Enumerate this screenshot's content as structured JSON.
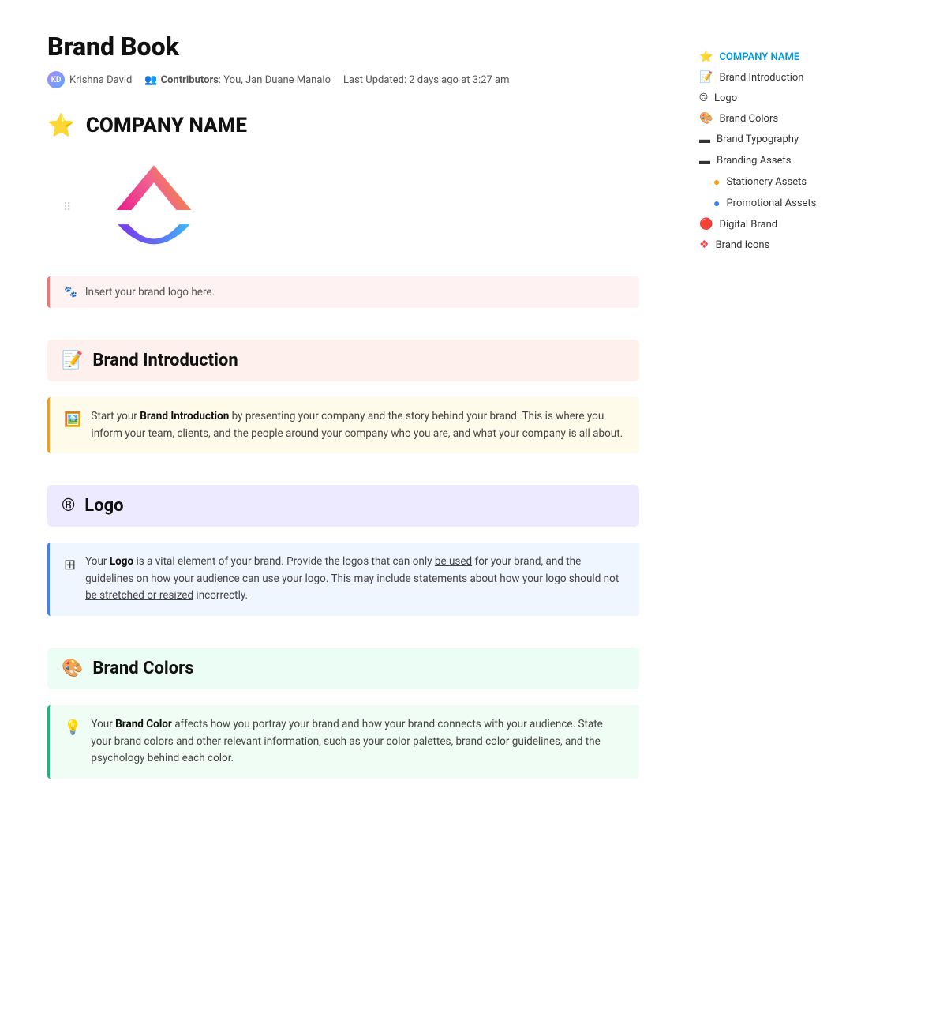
{
  "page": {
    "title": "Brand Book",
    "author": "Krishna David",
    "contributors_label": "Contributors",
    "contributors": "You, Jan Duane Manalo",
    "last_updated": "Last Updated: 2 days ago at 3:27 am",
    "company_name": "COMPANY NAME"
  },
  "logo_callout": {
    "text": "Insert your brand logo here."
  },
  "sections": [
    {
      "id": "brand-introduction",
      "icon": "📝",
      "title": "Brand Introduction",
      "bg": "pink-bg",
      "callout_type": "yellow-left",
      "callout_icon": "🖼️",
      "callout_text_before": "Start your ",
      "callout_bold": "Brand Introduction",
      "callout_text_after": " by presenting your company and the story behind your brand. This is where you inform your team, clients, and the people around your company who you are, and what your company is all about."
    },
    {
      "id": "logo",
      "icon": "®",
      "title": "Logo",
      "bg": "purple-bg",
      "callout_type": "blue-left",
      "callout_icon": "⊞",
      "callout_text_before": "Your ",
      "callout_bold": "Logo",
      "callout_text_after": " is a vital element of your brand. Provide the logos that can only ",
      "callout_underline": "be used",
      "callout_text_after2": " for your brand, and the guidelines on how your audience can use your logo. This may include statements about how your logo should not ",
      "callout_underline2": "be stretched or resized",
      "callout_text_after3": " incorrectly."
    },
    {
      "id": "brand-colors",
      "icon": "🎨",
      "title": "Brand Colors",
      "bg": "green-bg",
      "callout_type": "teal-left",
      "callout_icon": "💡",
      "callout_text_before": "Your ",
      "callout_bold": "Brand Color",
      "callout_text_after": " affects how you portray your brand and how your brand connects with your audience. State your brand colors and other relevant information, such as your color palettes, brand color guidelines, and the psychology behind each color."
    }
  ],
  "sidebar": {
    "items": [
      {
        "id": "company-name",
        "icon": "⭐",
        "label": "COMPANY NAME",
        "active": true,
        "color": "#0096d6"
      },
      {
        "id": "brand-introduction",
        "icon": "📝",
        "label": "Brand Introduction",
        "active": false
      },
      {
        "id": "logo",
        "icon": "©",
        "label": "Logo",
        "active": false
      },
      {
        "id": "brand-colors",
        "icon": "🎨",
        "label": "Brand Colors",
        "active": false
      },
      {
        "id": "brand-typography",
        "icon": "▬",
        "label": "Brand Typography",
        "active": false
      },
      {
        "id": "branding-assets",
        "icon": "▬",
        "label": "Branding Assets",
        "active": false
      },
      {
        "id": "stationery-assets",
        "icon": "🟡",
        "label": "Stationery Assets",
        "active": false,
        "indent": true
      },
      {
        "id": "promotional-assets",
        "icon": "🔵",
        "label": "Promotional Assets",
        "active": false,
        "indent": true
      },
      {
        "id": "digital-brand",
        "icon": "🔴",
        "label": "Digital Brand",
        "active": false
      },
      {
        "id": "brand-icons",
        "icon": "❖",
        "label": "Brand Icons",
        "active": false
      }
    ]
  }
}
